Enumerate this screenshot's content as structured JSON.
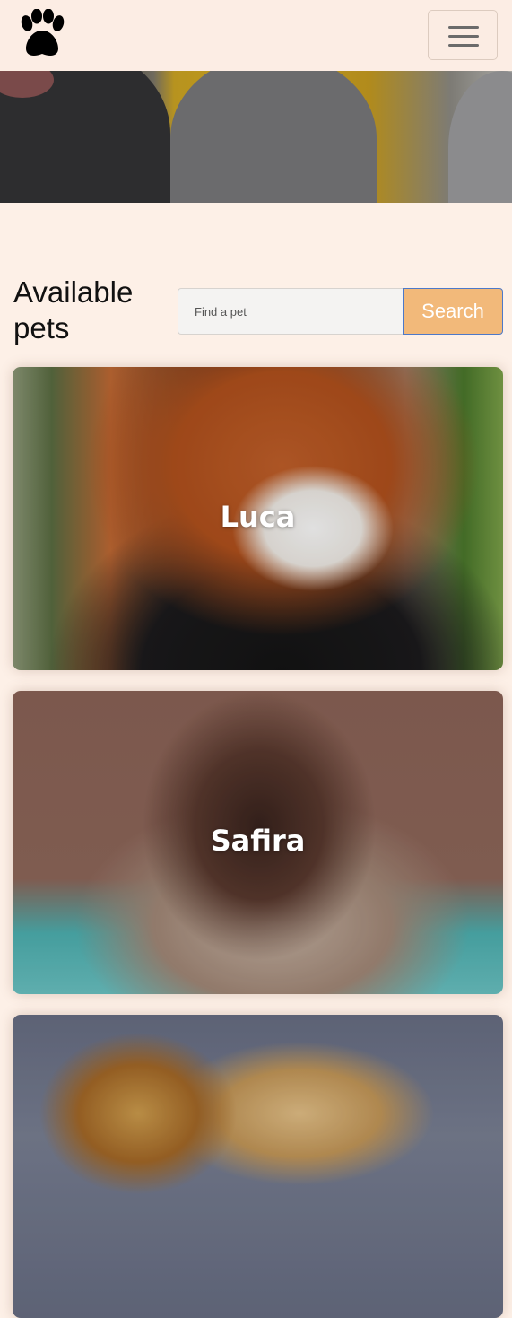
{
  "navbar": {
    "brand_icon": "paw-icon",
    "menu_icon": "hamburger-menu-icon"
  },
  "hero": {
    "image_alt": ""
  },
  "section": {
    "title": "Available pets"
  },
  "search": {
    "placeholder": "Find a pet",
    "value": "",
    "button_label": "Search"
  },
  "pets": [
    {
      "name": "Luca"
    },
    {
      "name": "Safira"
    },
    {
      "name": ""
    }
  ],
  "colors": {
    "background": "#fdf0e7",
    "search_button": "#f2b97a",
    "search_button_border": "#4d79c9",
    "text": "#111111"
  }
}
